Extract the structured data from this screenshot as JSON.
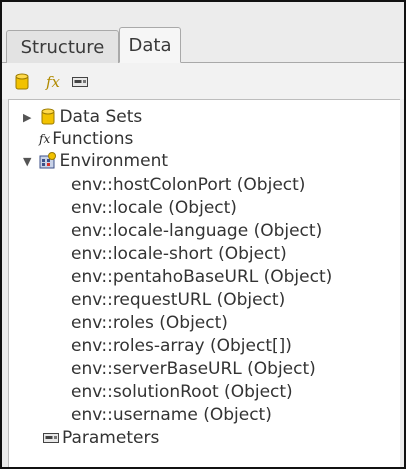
{
  "tabs": [
    {
      "label": "Structure",
      "active": false
    },
    {
      "label": "Data",
      "active": true
    }
  ],
  "toolbar": {
    "buttons": [
      {
        "icon": "database-icon"
      },
      {
        "icon": "function-icon",
        "glyph": "fx"
      },
      {
        "icon": "parameter-icon"
      }
    ]
  },
  "tree": {
    "data_sets": {
      "label": "Data Sets",
      "expanded": false
    },
    "functions": {
      "label": "Functions",
      "glyph": "fx"
    },
    "environment": {
      "label": "Environment",
      "expanded": true,
      "children": [
        "env::hostColonPort (Object)",
        "env::locale (Object)",
        "env::locale-language (Object)",
        "env::locale-short (Object)",
        "env::pentahoBaseURL (Object)",
        "env::requestURL (Object)",
        "env::roles (Object)",
        "env::roles-array (Object[])",
        "env::serverBaseURL (Object)",
        "env::solutionRoot (Object)",
        "env::username (Object)"
      ]
    },
    "parameters": {
      "label": "Parameters"
    }
  },
  "colors": {
    "database": "#f2c200",
    "function": "#b08a00",
    "accent_border": "#a9a9a9"
  }
}
